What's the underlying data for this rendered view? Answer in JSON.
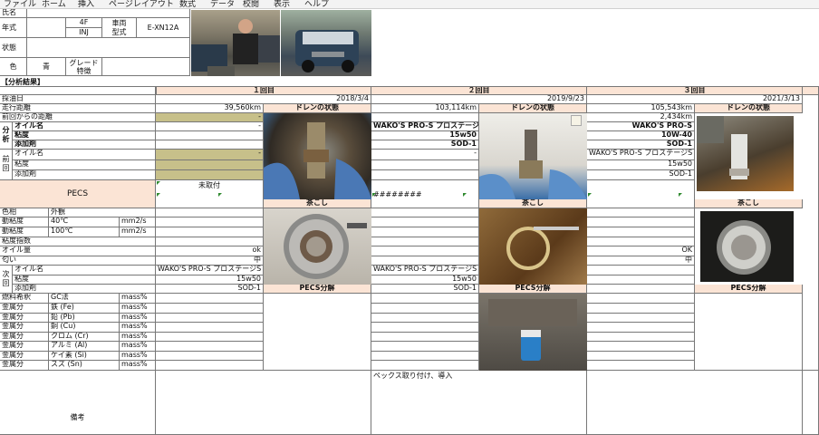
{
  "menu": [
    "ファイル",
    "ホーム",
    "挿入",
    "ページレイアウト",
    "数式",
    "データ",
    "校閲",
    "表示",
    "ヘルプ"
  ],
  "header": {
    "name_label": "氏名",
    "year_label": "年式",
    "engine_top": "4F",
    "engine_bottom": "INJ",
    "model_label_1": "車両",
    "model_label_2": "型式",
    "model_value": "E-XN12A",
    "state_label": "状態",
    "color_label": "色",
    "color_value": "青",
    "grade_label_1": "グレード",
    "grade_label_2": "特徴"
  },
  "section_title": "【分析結果】",
  "labels": {
    "date": "採油日",
    "distance": "走行距離",
    "since_last": "前回からの距離",
    "oil_name": "オイル名",
    "viscosity": "粘度",
    "additive": "添加剤",
    "analysis_side": "分析",
    "prev_side": "前回",
    "prev_oil": "オイル名",
    "prev_visc": "粘度",
    "prev_add": "添加剤",
    "pecs": "PECS",
    "color_hue": "色相",
    "appearance": "外観",
    "visc40_l": "動粘度",
    "visc40_t": "40℃",
    "visc40_u": "mm2/s",
    "visc100_l": "動粘度",
    "visc100_t": "100℃",
    "visc100_u": "mm2/s",
    "vi": "粘度指数",
    "oil_amount": "オイル量",
    "smell": "匂い",
    "next_side": "次回",
    "next_oil": "オイル名",
    "next_visc": "粘度",
    "next_add": "添加剤",
    "fuel": "燃料希釈",
    "fuel_t": "GC法",
    "fuel_u": "mass%",
    "metal": "金属分",
    "fe": "鉄 (Fe)",
    "pb": "鉛 (Pb)",
    "cu": "銅 (Cu)",
    "cr": "クロム (Cr)",
    "al": "アルミ (Al)",
    "si": "ケイ素 (Si)",
    "sn": "スズ (Sn)",
    "mass": "mass%",
    "remarks": "備考"
  },
  "rounds": [
    {
      "title": "１回目",
      "date": "2018/3/4",
      "distance": "39,560km",
      "since": "-",
      "oil": "-",
      "visc": "",
      "add": "",
      "prev_oil": "-",
      "pecs": "未取付",
      "oil_amount": "ok",
      "smell": "中",
      "next_oil": "WAKO'S PRO-S プロステージS",
      "next_visc": "15w50",
      "next_add": "SOD-1",
      "remarks": ""
    },
    {
      "title": "２回目",
      "date": "2019/9/23",
      "distance": "103,114km",
      "since": "",
      "oil": "WAKO'S PRO-S プロステージS",
      "visc": "15w50",
      "add": "SOD-1",
      "prev_oil": "-",
      "pecs": "########",
      "oil_amount": "",
      "smell": "",
      "next_oil": "WAKO'S PRO-S プロステージS",
      "next_visc": "15w50",
      "next_add": "SOD-1",
      "remarks": "ペックス取り付け、導入"
    },
    {
      "title": "３回目",
      "date": "2021/3/13",
      "distance": "105,543km",
      "since": "2,434km",
      "oil": "WAKO'S PRO-S",
      "visc": "10W-40",
      "add": "SOD-1",
      "prev_oil": "WAKO'S PRO-S プロステージS",
      "prev_visc": "15w50",
      "prev_add": "SOD-1",
      "pecs": "",
      "oil_amount": "OK",
      "smell": "中",
      "next_oil": "",
      "next_visc": "",
      "next_add": "",
      "remarks": ""
    }
  ],
  "panels": {
    "drain": "ドレンの状態",
    "strainer": "茶こし",
    "pecs_disasm": "PECS分解"
  },
  "colors": {
    "peach": "#fbe4d5",
    "olive": "#c7c08a",
    "grid": "#777777"
  }
}
